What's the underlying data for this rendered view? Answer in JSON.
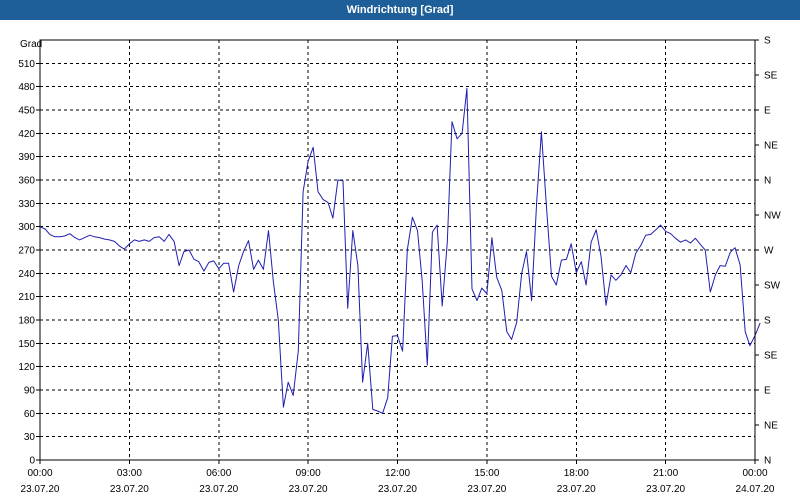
{
  "window": {
    "title": "Windrichtung [Grad]"
  },
  "chart_data": {
    "type": "line",
    "title": "Windrichtung [Grad]",
    "ylabel": "Grad",
    "ylim": [
      0,
      540
    ],
    "yticks": [
      0,
      30,
      60,
      90,
      120,
      150,
      180,
      210,
      240,
      270,
      300,
      330,
      360,
      390,
      420,
      450,
      480,
      510
    ],
    "xlim_hours": [
      0,
      24
    ],
    "xticks": [
      {
        "time": "00:00",
        "date": "23.07.20",
        "hour": 0
      },
      {
        "time": "03:00",
        "date": "23.07.20",
        "hour": 3
      },
      {
        "time": "06:00",
        "date": "23.07.20",
        "hour": 6
      },
      {
        "time": "09:00",
        "date": "23.07.20",
        "hour": 9
      },
      {
        "time": "12:00",
        "date": "23.07.20",
        "hour": 12
      },
      {
        "time": "15:00",
        "date": "23.07.20",
        "hour": 15
      },
      {
        "time": "18:00",
        "date": "23.07.20",
        "hour": 18
      },
      {
        "time": "21:00",
        "date": "23.07.20",
        "hour": 21
      },
      {
        "time": "00:00",
        "date": "24.07.20",
        "hour": 24
      }
    ],
    "right_axis": {
      "labels": [
        {
          "label": "N",
          "value": 0
        },
        {
          "label": "NE",
          "value": 45
        },
        {
          "label": "E",
          "value": 90
        },
        {
          "label": "SE",
          "value": 135
        },
        {
          "label": "S",
          "value": 180
        },
        {
          "label": "SW",
          "value": 225
        },
        {
          "label": "W",
          "value": 270
        },
        {
          "label": "NW",
          "value": 315
        },
        {
          "label": "N",
          "value": 360
        },
        {
          "label": "NE",
          "value": 405
        },
        {
          "label": "E",
          "value": 450
        },
        {
          "label": "SE",
          "value": 495
        },
        {
          "label": "S",
          "value": 540
        }
      ]
    },
    "grid": true,
    "colors": {
      "line": "#1f1fb0",
      "grid": "#000000",
      "title_bar": "#1f5f99"
    },
    "series": [
      {
        "name": "",
        "points": [
          [
            0.0,
            300
          ],
          [
            0.17,
            297
          ],
          [
            0.33,
            290
          ],
          [
            0.5,
            287
          ],
          [
            0.67,
            287
          ],
          [
            0.83,
            288
          ],
          [
            1.0,
            291
          ],
          [
            1.17,
            286
          ],
          [
            1.33,
            283
          ],
          [
            1.5,
            286
          ],
          [
            1.67,
            289
          ],
          [
            1.83,
            287
          ],
          [
            2.0,
            286
          ],
          [
            2.17,
            284
          ],
          [
            2.33,
            283
          ],
          [
            2.5,
            281
          ],
          [
            2.67,
            275
          ],
          [
            2.83,
            271
          ],
          [
            3.0,
            278
          ],
          [
            3.17,
            283
          ],
          [
            3.33,
            281
          ],
          [
            3.5,
            283
          ],
          [
            3.67,
            281
          ],
          [
            3.83,
            286
          ],
          [
            4.0,
            287
          ],
          [
            4.17,
            281
          ],
          [
            4.33,
            290
          ],
          [
            4.5,
            281
          ],
          [
            4.67,
            250
          ],
          [
            4.83,
            268
          ],
          [
            5.0,
            270
          ],
          [
            5.17,
            258
          ],
          [
            5.33,
            255
          ],
          [
            5.5,
            243
          ],
          [
            5.67,
            254
          ],
          [
            5.83,
            256
          ],
          [
            6.0,
            246
          ],
          [
            6.17,
            253
          ],
          [
            6.33,
            253
          ],
          [
            6.5,
            216
          ],
          [
            6.67,
            250
          ],
          [
            6.83,
            268
          ],
          [
            7.0,
            282
          ],
          [
            7.17,
            245
          ],
          [
            7.33,
            257
          ],
          [
            7.5,
            245
          ],
          [
            7.67,
            295
          ],
          [
            7.83,
            230
          ],
          [
            8.0,
            180
          ],
          [
            8.17,
            68
          ],
          [
            8.33,
            100
          ],
          [
            8.5,
            83
          ],
          [
            8.67,
            140
          ],
          [
            8.83,
            345
          ],
          [
            9.0,
            384
          ],
          [
            9.17,
            402
          ],
          [
            9.33,
            345
          ],
          [
            9.5,
            335
          ],
          [
            9.67,
            331
          ],
          [
            9.83,
            311
          ],
          [
            10.0,
            360
          ],
          [
            10.17,
            359
          ],
          [
            10.33,
            195
          ],
          [
            10.5,
            295
          ],
          [
            10.67,
            250
          ],
          [
            10.83,
            100
          ],
          [
            11.0,
            150
          ],
          [
            11.17,
            65
          ],
          [
            11.33,
            63
          ],
          [
            11.5,
            60
          ],
          [
            11.67,
            80
          ],
          [
            11.83,
            159
          ],
          [
            12.0,
            160
          ],
          [
            12.17,
            140
          ],
          [
            12.33,
            270
          ],
          [
            12.5,
            312
          ],
          [
            12.67,
            295
          ],
          [
            12.83,
            230
          ],
          [
            13.0,
            122
          ],
          [
            13.17,
            293
          ],
          [
            13.33,
            302
          ],
          [
            13.5,
            198
          ],
          [
            13.67,
            280
          ],
          [
            13.83,
            435
          ],
          [
            14.0,
            413
          ],
          [
            14.17,
            420
          ],
          [
            14.33,
            478
          ],
          [
            14.5,
            220
          ],
          [
            14.67,
            205
          ],
          [
            14.83,
            221
          ],
          [
            15.0,
            214
          ],
          [
            15.17,
            286
          ],
          [
            15.33,
            235
          ],
          [
            15.5,
            218
          ],
          [
            15.67,
            165
          ],
          [
            15.83,
            155
          ],
          [
            16.0,
            177
          ],
          [
            16.17,
            240
          ],
          [
            16.33,
            268
          ],
          [
            16.5,
            205
          ],
          [
            16.67,
            330
          ],
          [
            16.83,
            422
          ],
          [
            17.0,
            325
          ],
          [
            17.17,
            236
          ],
          [
            17.33,
            225
          ],
          [
            17.5,
            257
          ],
          [
            17.67,
            258
          ],
          [
            17.83,
            278
          ],
          [
            18.0,
            241
          ],
          [
            18.17,
            255
          ],
          [
            18.33,
            225
          ],
          [
            18.5,
            280
          ],
          [
            18.67,
            296
          ],
          [
            18.83,
            262
          ],
          [
            19.0,
            199
          ],
          [
            19.17,
            238
          ],
          [
            19.33,
            231
          ],
          [
            19.5,
            238
          ],
          [
            19.67,
            250
          ],
          [
            19.83,
            241
          ],
          [
            20.0,
            266
          ],
          [
            20.17,
            276
          ],
          [
            20.33,
            289
          ],
          [
            20.5,
            290
          ],
          [
            20.67,
            296
          ],
          [
            20.83,
            302
          ],
          [
            21.0,
            294
          ],
          [
            21.17,
            291
          ],
          [
            21.33,
            285
          ],
          [
            21.5,
            280
          ],
          [
            21.67,
            283
          ],
          [
            21.83,
            279
          ],
          [
            22.0,
            285
          ],
          [
            22.17,
            277
          ],
          [
            22.33,
            270
          ],
          [
            22.5,
            216
          ],
          [
            22.67,
            238
          ],
          [
            22.83,
            250
          ],
          [
            23.0,
            249
          ],
          [
            23.17,
            267
          ],
          [
            23.33,
            273
          ],
          [
            23.5,
            251
          ],
          [
            23.67,
            165
          ],
          [
            23.83,
            147
          ],
          [
            24.0,
            160
          ],
          [
            24.17,
            176
          ]
        ]
      }
    ]
  }
}
